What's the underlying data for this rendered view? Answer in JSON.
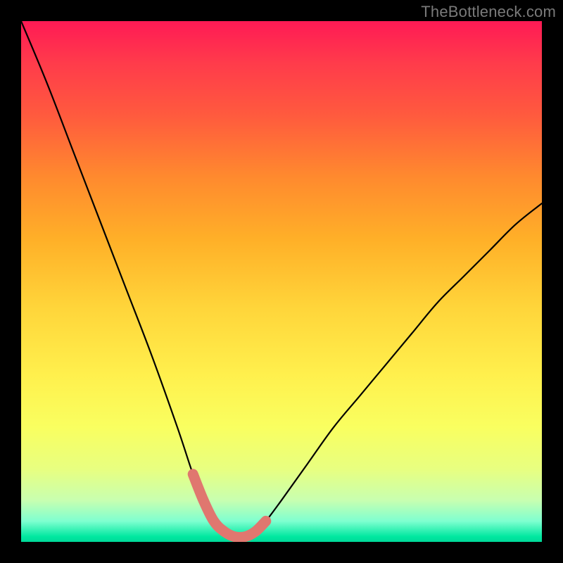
{
  "watermark": "TheBottleneck.com",
  "chart_data": {
    "type": "line",
    "title": "",
    "xlabel": "",
    "ylabel": "",
    "xlim": [
      0,
      100
    ],
    "ylim": [
      0,
      100
    ],
    "series": [
      {
        "name": "bottleneck-curve",
        "x": [
          0,
          5,
          10,
          15,
          20,
          25,
          30,
          33,
          35,
          37,
          39,
          41,
          43,
          45,
          47,
          50,
          55,
          60,
          65,
          70,
          75,
          80,
          85,
          90,
          95,
          100
        ],
        "values": [
          100,
          88,
          75,
          62,
          49,
          36,
          22,
          13,
          8,
          4,
          2,
          1,
          1,
          2,
          4,
          8,
          15,
          22,
          28,
          34,
          40,
          46,
          51,
          56,
          61,
          65
        ]
      },
      {
        "name": "highlight-u",
        "x": [
          33,
          35,
          37,
          39,
          41,
          43,
          45,
          47
        ],
        "values": [
          13,
          8,
          4,
          2,
          1,
          1,
          2,
          4
        ]
      }
    ],
    "background_gradient": {
      "top": "#ff1a55",
      "bottom": "#00d898",
      "note": "vertical red-to-green through orange/yellow"
    },
    "highlight_color": "#e0776f"
  }
}
